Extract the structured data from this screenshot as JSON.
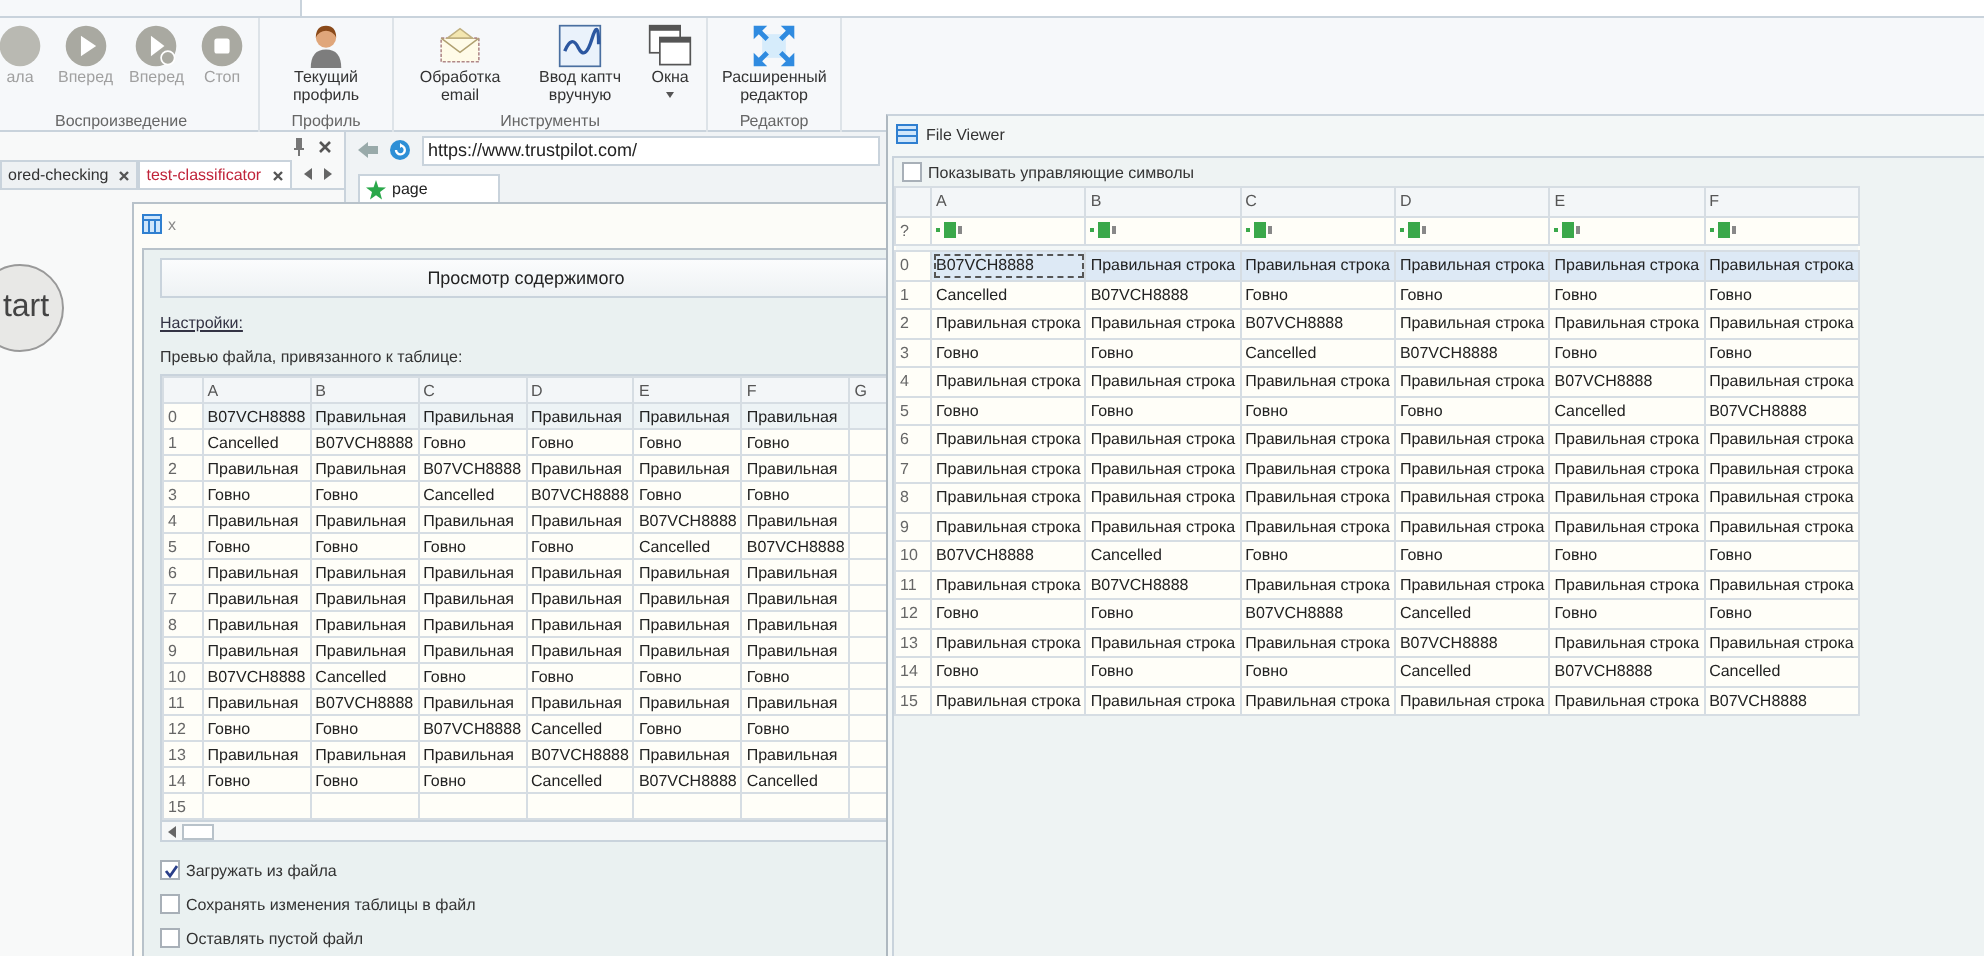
{
  "ribbon": {
    "groups": [
      {
        "label": "Воспроизведение",
        "buttons": [
          {
            "label": "ала",
            "kind": "circle",
            "disabled": true
          },
          {
            "label": "Вперед",
            "kind": "play",
            "disabled": true
          },
          {
            "label": "Вперед",
            "kind": "step",
            "disabled": true
          },
          {
            "label": "Стоп",
            "kind": "stop",
            "disabled": true
          }
        ]
      },
      {
        "label": "Профиль",
        "buttons": [
          {
            "label": "Текущий профиль",
            "kind": "profile",
            "disabled": false
          }
        ]
      },
      {
        "label": "Инструменты",
        "buttons": [
          {
            "label": "Обработка email",
            "kind": "email",
            "disabled": false
          },
          {
            "label": "Ввод каптч вручную",
            "kind": "captcha",
            "disabled": false
          },
          {
            "label": "Окна",
            "kind": "windows",
            "disabled": false,
            "has_menu": true
          }
        ]
      },
      {
        "label": "Редактор",
        "buttons": [
          {
            "label": "Расширенный редактор",
            "kind": "expand",
            "disabled": false
          }
        ]
      }
    ]
  },
  "left_panel": {
    "tabs": [
      {
        "label": "ored-checking",
        "selected": false
      },
      {
        "label": "test-classificator",
        "selected": true
      }
    ],
    "start_button": "tart"
  },
  "browser": {
    "url": "https://www.trustpilot.com/",
    "tabs": [
      {
        "label": "page",
        "selected": true
      }
    ]
  },
  "dialog": {
    "title": "x",
    "view_button": "Просмотр содержимого",
    "settings_link": "Настройки:",
    "preview_caption": "Превью файла, привязанного к таблице:",
    "table": {
      "columns": [
        "A",
        "B",
        "C",
        "D",
        "E",
        "F",
        "G"
      ],
      "rows": [
        {
          "index": "0",
          "selected": true,
          "cells": [
            "B07VCH8888",
            "Правильная",
            "Правильная",
            "Правильная",
            "Правильная",
            "Правильная"
          ]
        },
        {
          "index": "1",
          "selected": false,
          "cells": [
            "Cancelled",
            "B07VCH8888",
            "Говно",
            "Говно",
            "Говно",
            "Говно"
          ]
        },
        {
          "index": "2",
          "selected": false,
          "cells": [
            "Правильная",
            "Правильная",
            "B07VCH8888",
            "Правильная",
            "Правильная",
            "Правильная"
          ]
        },
        {
          "index": "3",
          "selected": false,
          "cells": [
            "Говно",
            "Говно",
            "Cancelled",
            "B07VCH8888",
            "Говно",
            "Говно"
          ]
        },
        {
          "index": "4",
          "selected": false,
          "cells": [
            "Правильная",
            "Правильная",
            "Правильная",
            "Правильная",
            "B07VCH8888",
            "Правильная"
          ]
        },
        {
          "index": "5",
          "selected": false,
          "cells": [
            "Говно",
            "Говно",
            "Говно",
            "Говно",
            "Cancelled",
            "B07VCH8888"
          ]
        },
        {
          "index": "6",
          "selected": false,
          "cells": [
            "Правильная",
            "Правильная",
            "Правильная",
            "Правильная",
            "Правильная",
            "Правильная"
          ]
        },
        {
          "index": "7",
          "selected": false,
          "cells": [
            "Правильная",
            "Правильная",
            "Правильная",
            "Правильная",
            "Правильная",
            "Правильная"
          ]
        },
        {
          "index": "8",
          "selected": false,
          "cells": [
            "Правильная",
            "Правильная",
            "Правильная",
            "Правильная",
            "Правильная",
            "Правильная"
          ]
        },
        {
          "index": "9",
          "selected": false,
          "cells": [
            "Правильная",
            "Правильная",
            "Правильная",
            "Правильная",
            "Правильная",
            "Правильная"
          ]
        },
        {
          "index": "10",
          "selected": false,
          "cells": [
            "B07VCH8888",
            "Cancelled",
            "Говно",
            "Говно",
            "Говно",
            "Говно"
          ]
        },
        {
          "index": "11",
          "selected": false,
          "cells": [
            "Правильная",
            "B07VCH8888",
            "Правильная",
            "Правильная",
            "Правильная",
            "Правильная"
          ]
        },
        {
          "index": "12",
          "selected": false,
          "cells": [
            "Говно",
            "Говно",
            "B07VCH8888",
            "Cancelled",
            "Говно",
            "Говно"
          ]
        },
        {
          "index": "13",
          "selected": false,
          "cells": [
            "Правильная",
            "Правильная",
            "Правильная",
            "B07VCH8888",
            "Правильная",
            "Правильная"
          ]
        },
        {
          "index": "14",
          "selected": false,
          "cells": [
            "Говно",
            "Говно",
            "Говно",
            "Cancelled",
            "B07VCH8888",
            "Cancelled"
          ]
        },
        {
          "index": "15",
          "selected": false,
          "cells": []
        }
      ]
    },
    "options": [
      {
        "label": "Загружать из файла",
        "checked": true
      },
      {
        "label": "Сохранять изменения таблицы в файл",
        "checked": false
      },
      {
        "label": "Оставлять пустой файл",
        "checked": false
      }
    ]
  },
  "file_viewer": {
    "title": "File Viewer",
    "show_control_chars": {
      "label": "Показывать управляющие символы",
      "checked": false
    },
    "table": {
      "columns": [
        "A",
        "B",
        "C",
        "D",
        "E",
        "F"
      ],
      "type_row_marker": "?",
      "rows": [
        {
          "index": "0",
          "selected": true,
          "cells": [
            "B07VCH8888",
            "Правильная строка",
            "Правильная строка",
            "Правильная строка",
            "Правильная строка",
            "Правильная строка"
          ]
        },
        {
          "index": "1",
          "selected": false,
          "cells": [
            "Cancelled",
            "B07VCH8888",
            "Говно",
            "Говно",
            "Говно",
            "Говно"
          ]
        },
        {
          "index": "2",
          "selected": false,
          "cells": [
            "Правильная строка",
            "Правильная строка",
            "B07VCH8888",
            "Правильная строка",
            "Правильная строка",
            "Правильная строка"
          ]
        },
        {
          "index": "3",
          "selected": false,
          "cells": [
            "Говно",
            "Говно",
            "Cancelled",
            "B07VCH8888",
            "Говно",
            "Говно"
          ]
        },
        {
          "index": "4",
          "selected": false,
          "cells": [
            "Правильная строка",
            "Правильная строка",
            "Правильная строка",
            "Правильная строка",
            "B07VCH8888",
            "Правильная строка"
          ]
        },
        {
          "index": "5",
          "selected": false,
          "cells": [
            "Говно",
            "Говно",
            "Говно",
            "Говно",
            "Cancelled",
            "B07VCH8888"
          ]
        },
        {
          "index": "6",
          "selected": false,
          "cells": [
            "Правильная строка",
            "Правильная строка",
            "Правильная строка",
            "Правильная строка",
            "Правильная строка",
            "Правильная строка"
          ]
        },
        {
          "index": "7",
          "selected": false,
          "cells": [
            "Правильная строка",
            "Правильная строка",
            "Правильная строка",
            "Правильная строка",
            "Правильная строка",
            "Правильная строка"
          ]
        },
        {
          "index": "8",
          "selected": false,
          "cells": [
            "Правильная строка",
            "Правильная строка",
            "Правильная строка",
            "Правильная строка",
            "Правильная строка",
            "Правильная строка"
          ]
        },
        {
          "index": "9",
          "selected": false,
          "cells": [
            "Правильная строка",
            "Правильная строка",
            "Правильная строка",
            "Правильная строка",
            "Правильная строка",
            "Правильная строка"
          ]
        },
        {
          "index": "10",
          "selected": false,
          "cells": [
            "B07VCH8888",
            "Cancelled",
            "Говно",
            "Говно",
            "Говно",
            "Говно"
          ]
        },
        {
          "index": "11",
          "selected": false,
          "cells": [
            "Правильная строка",
            "B07VCH8888",
            "Правильная строка",
            "Правильная строка",
            "Правильная строка",
            "Правильная строка"
          ]
        },
        {
          "index": "12",
          "selected": false,
          "cells": [
            "Говно",
            "Говно",
            "B07VCH8888",
            "Cancelled",
            "Говно",
            "Говно"
          ]
        },
        {
          "index": "13",
          "selected": false,
          "cells": [
            "Правильная строка",
            "Правильная строка",
            "Правильная строка",
            "B07VCH8888",
            "Правильная строка",
            "Правильная строка"
          ]
        },
        {
          "index": "14",
          "selected": false,
          "cells": [
            "Говно",
            "Говно",
            "Говно",
            "Cancelled",
            "B07VCH8888",
            "Cancelled"
          ]
        },
        {
          "index": "15",
          "selected": false,
          "cells": [
            "Правильная строка",
            "Правильная строка",
            "Правильная строка",
            "Правильная строка",
            "Правильная строка",
            "B07VCH8888"
          ]
        }
      ]
    }
  }
}
